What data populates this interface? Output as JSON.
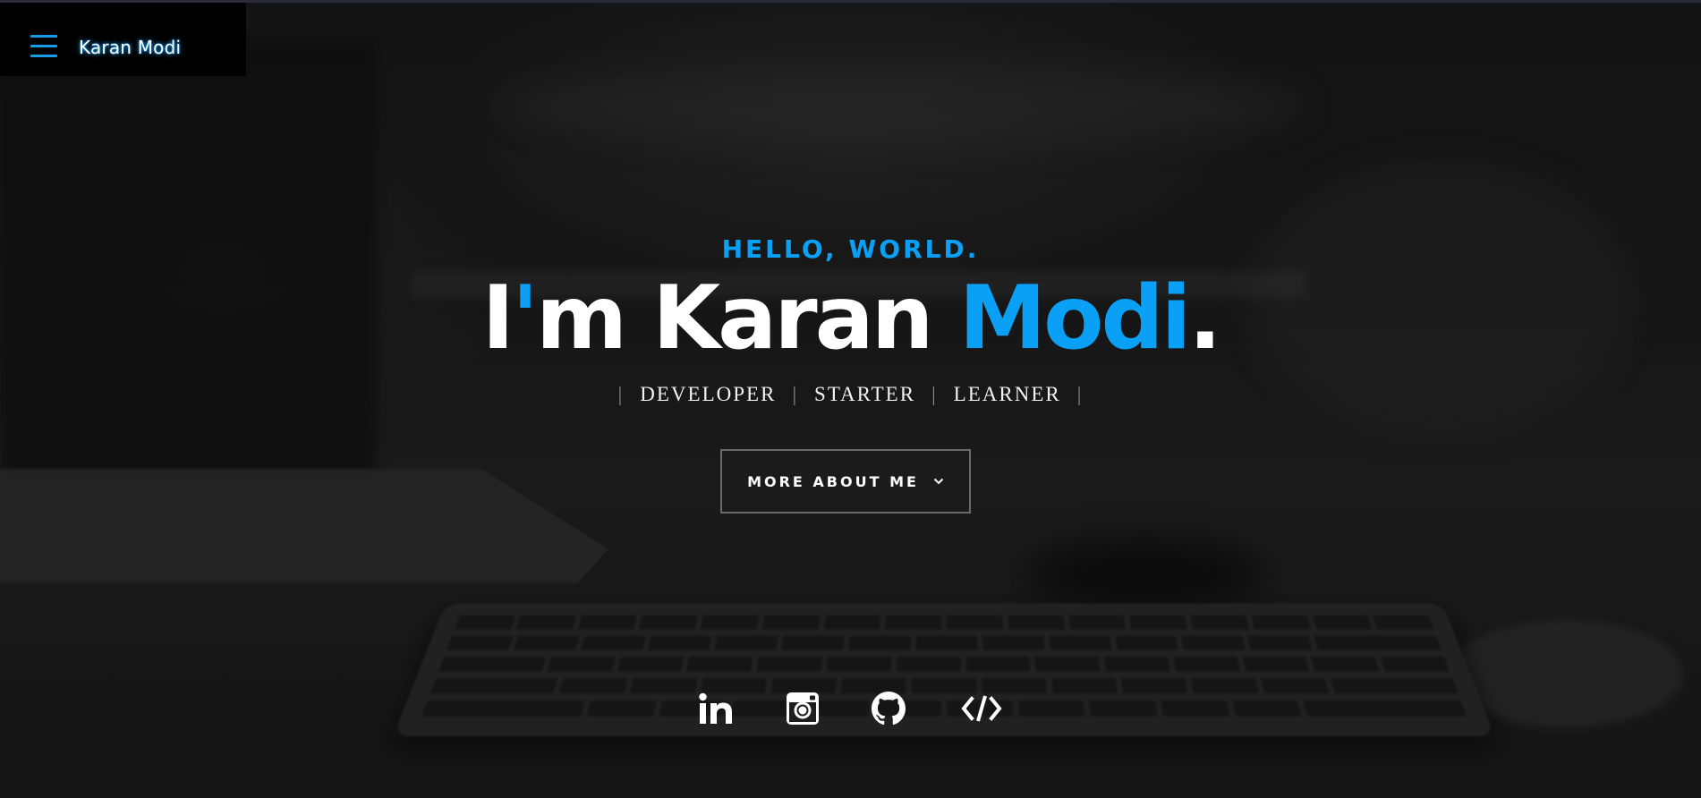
{
  "header": {
    "brand": "Karan Modi",
    "menu_icon": "hamburger-menu-icon"
  },
  "hero": {
    "greeting": "HELLO, WORLD.",
    "headline_prefix": "I",
    "headline_apostrophe": "'",
    "headline_middle": "m Karan ",
    "headline_accent": "Modi",
    "headline_period": ".",
    "roles": [
      "DEVELOPER",
      "STARTER",
      "LEARNER"
    ],
    "role_separator": "|",
    "cta_label": "MORE ABOUT ME",
    "cta_icon": "chevron-down-icon"
  },
  "social": [
    {
      "name": "linkedin",
      "icon": "linkedin-icon"
    },
    {
      "name": "instagram",
      "icon": "instagram-icon"
    },
    {
      "name": "github",
      "icon": "github-icon"
    },
    {
      "name": "code",
      "icon": "code-icon"
    }
  ],
  "colors": {
    "accent": "#0aa0f5",
    "brand_glow": "#1aa3ff",
    "background": "#1c1c1c",
    "header_box": "#000000"
  }
}
